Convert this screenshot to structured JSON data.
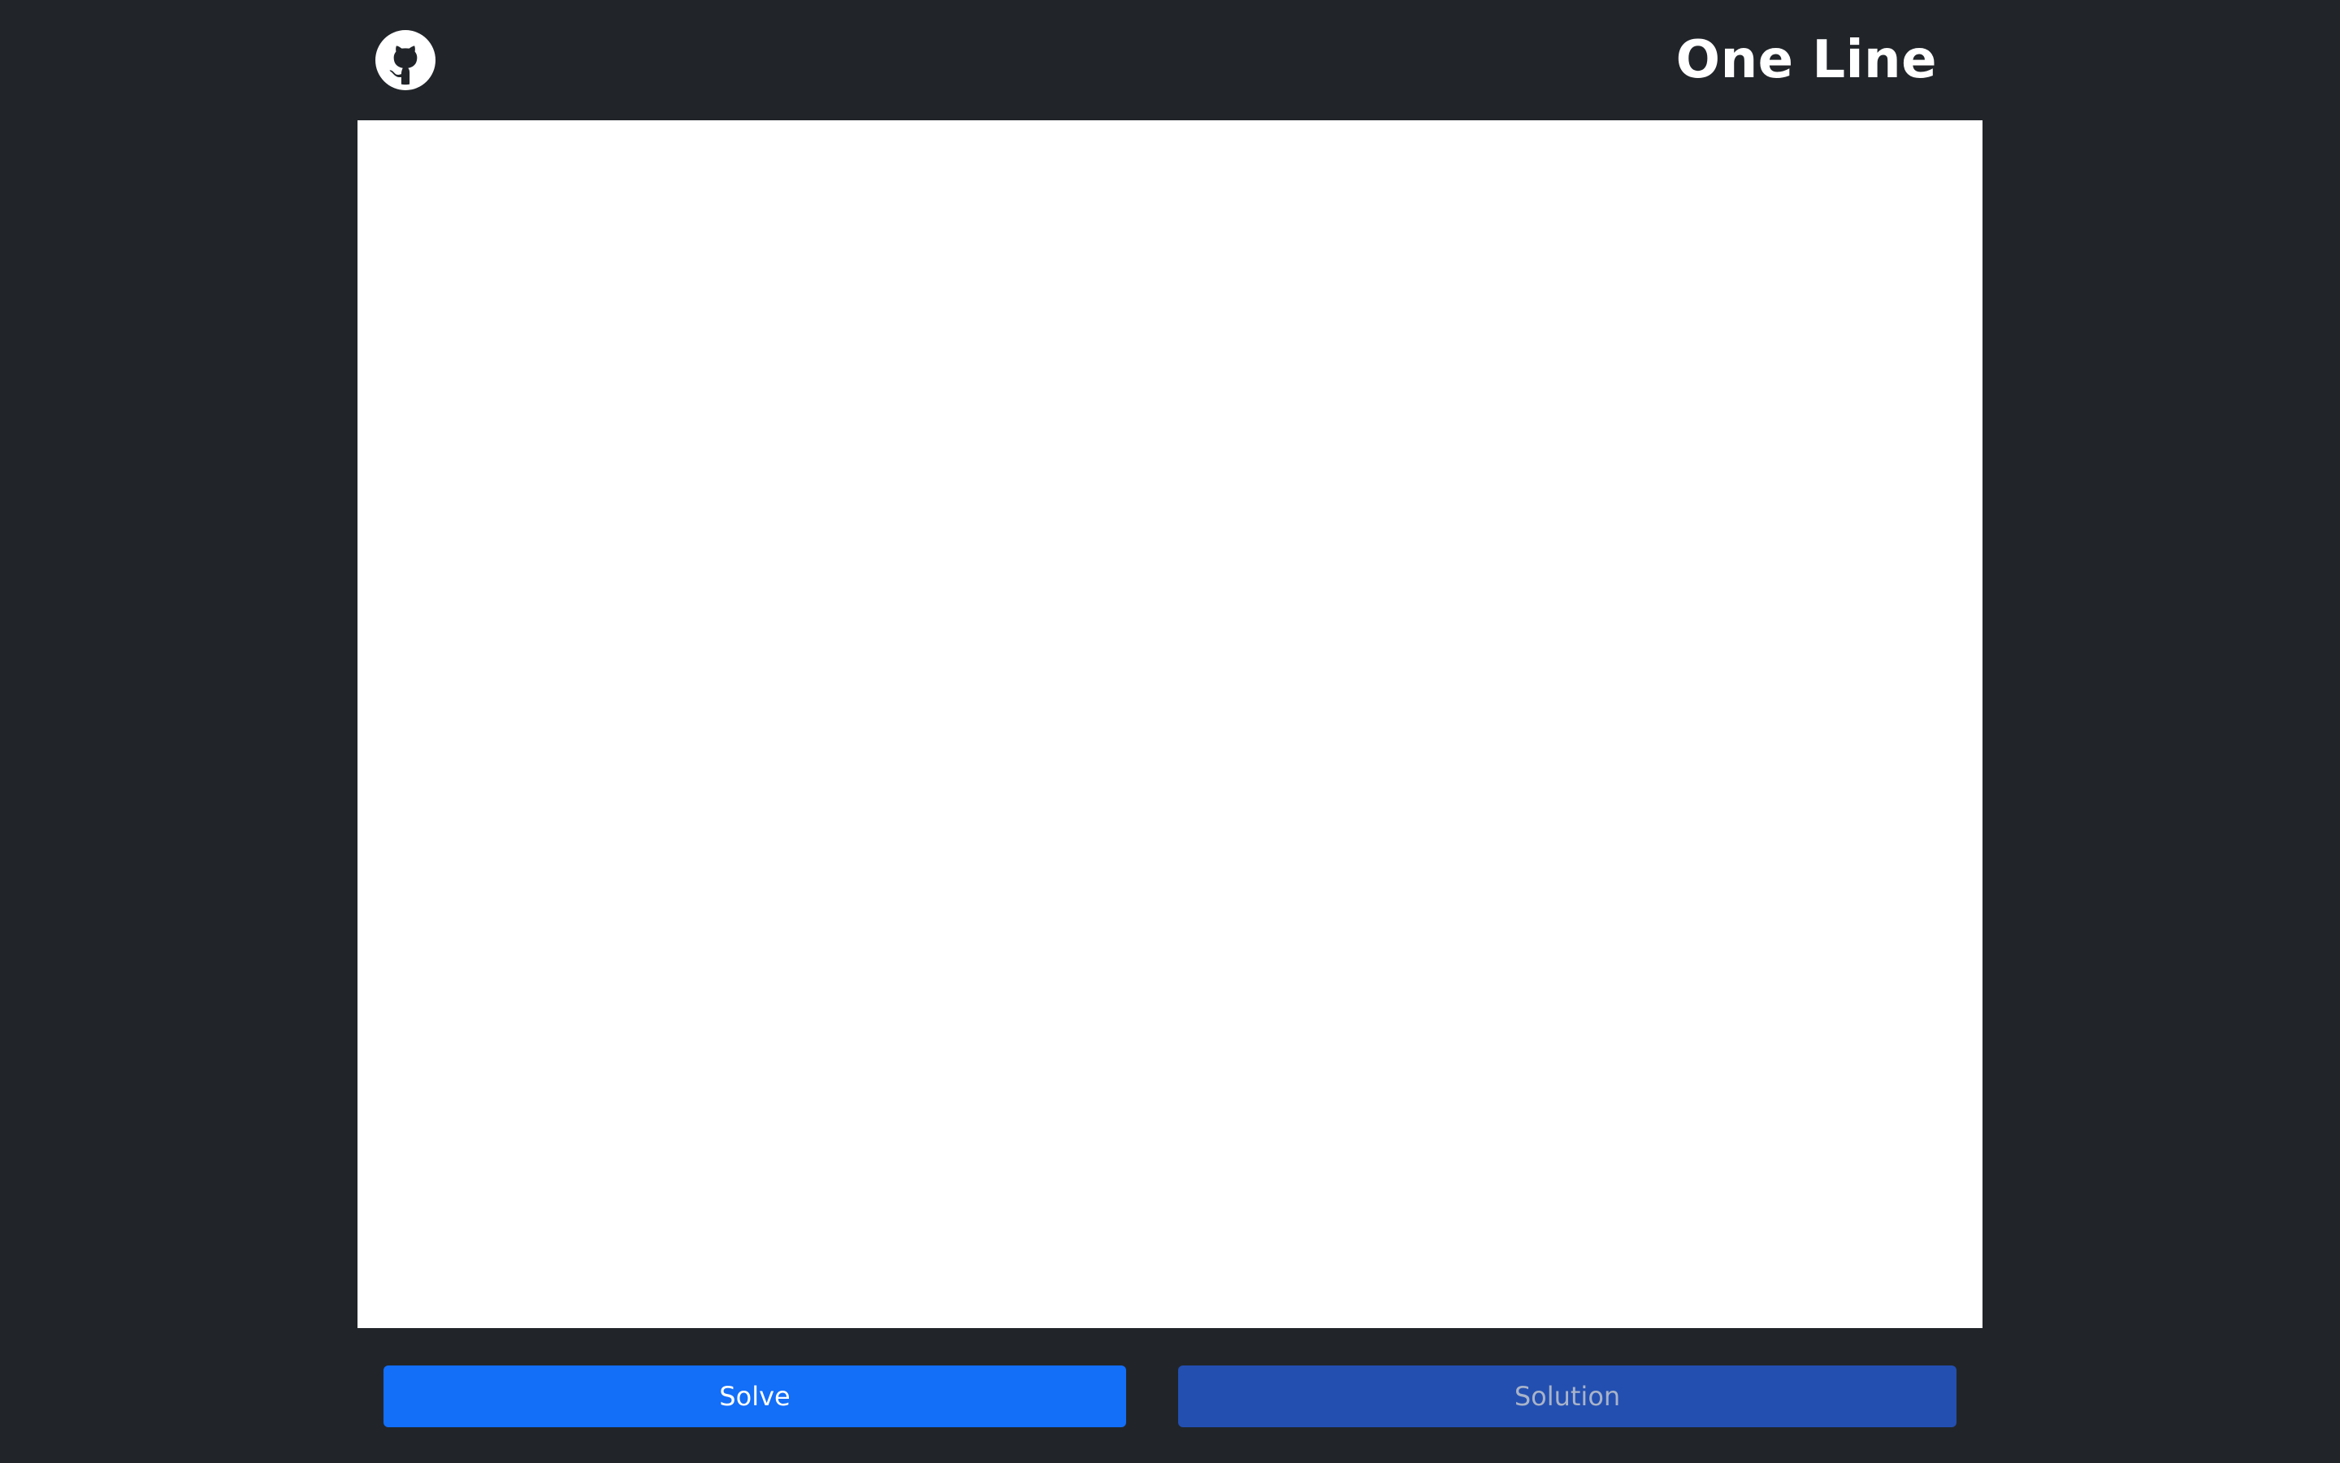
{
  "header": {
    "title": "One Line",
    "github_icon": "github-icon"
  },
  "board": {
    "background": "#ffffff"
  },
  "actions": {
    "solve_label": "Solve",
    "solution_label": "Solution"
  },
  "colors": {
    "page_background": "#212529",
    "solve_button": "#136ef8",
    "solution_button": "#234fb1",
    "solution_text": "#a8b3c9"
  }
}
